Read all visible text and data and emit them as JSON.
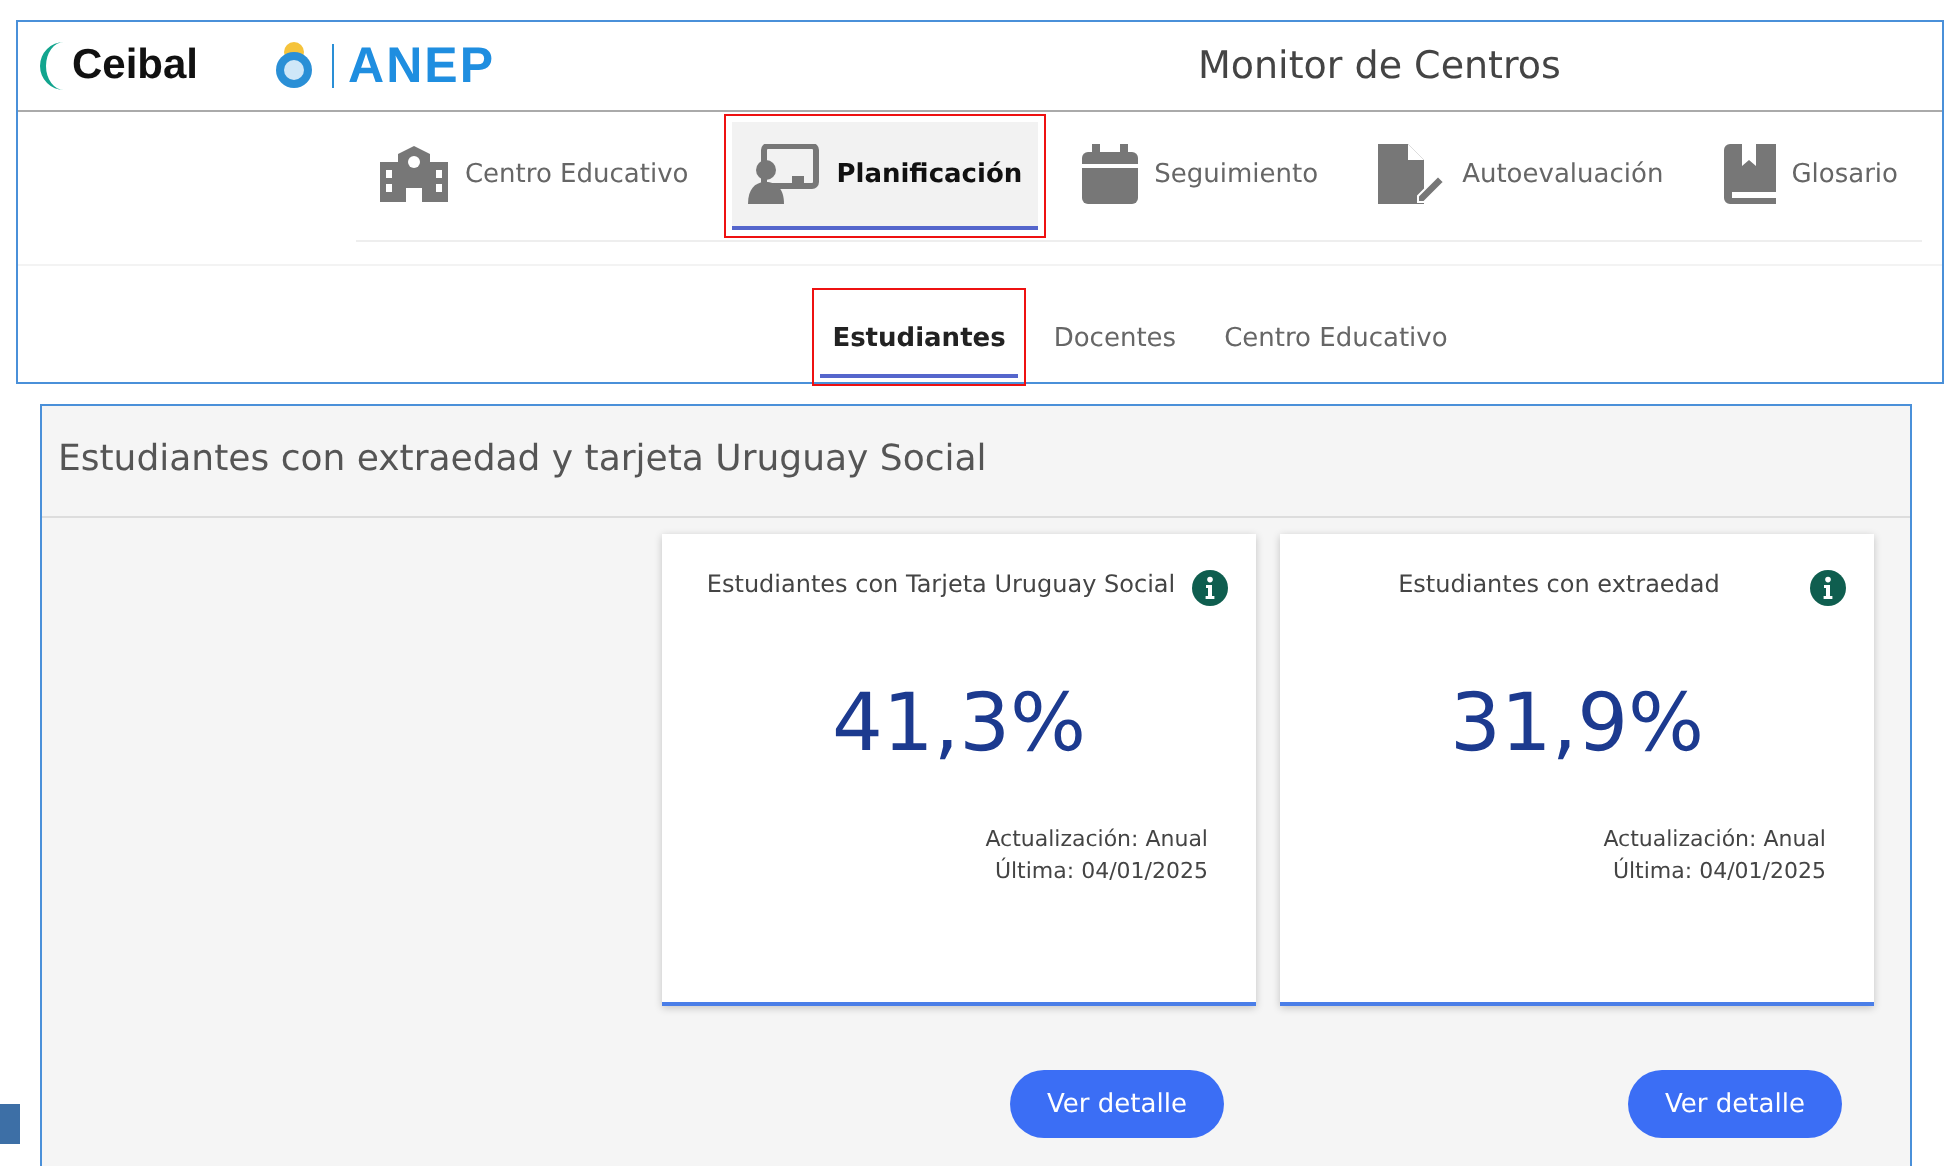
{
  "header": {
    "logos": [
      "Ceibal",
      "ANEP"
    ],
    "title": "Monitor de Centros"
  },
  "main_tabs": [
    {
      "label": "Centro Educativo",
      "kind": "school",
      "selected": false,
      "highlighted": false
    },
    {
      "label": "Planificación",
      "kind": "presenter",
      "selected": true,
      "highlighted": true
    },
    {
      "label": "Seguimiento",
      "kind": "calendar",
      "selected": false,
      "highlighted": false
    },
    {
      "label": "Autoevaluación",
      "kind": "document",
      "selected": false,
      "highlighted": false
    },
    {
      "label": "Glosario",
      "kind": "book",
      "selected": false,
      "highlighted": false
    }
  ],
  "sub_tabs": [
    {
      "label": "Estudiantes",
      "selected": true,
      "highlighted": true
    },
    {
      "label": "Docentes",
      "selected": false,
      "highlighted": false
    },
    {
      "label": "Centro Educativo",
      "selected": false,
      "highlighted": false
    }
  ],
  "section": {
    "title": "Estudiantes con extraedad y tarjeta Uruguay Social",
    "cards": [
      {
        "title": "Estudiantes con Tarjeta Uruguay Social",
        "value": "41,3%",
        "update": "Actualización: Anual",
        "last": "Última: 04/01/2025",
        "button": "Ver detalle"
      },
      {
        "title": "Estudiantes con extraedad",
        "value": "31,9%",
        "update": "Actualización: Anual",
        "last": "Última: 04/01/2025",
        "button": "Ver detalle"
      }
    ]
  }
}
